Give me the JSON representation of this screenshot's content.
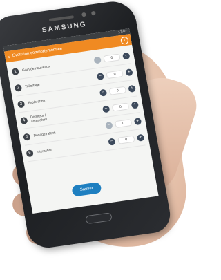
{
  "phone": {
    "brand": "SAMSUNG",
    "status_time": "17:02"
  },
  "app": {
    "title": "Evolution comportementale"
  },
  "rows": [
    {
      "num": "1",
      "label": "Gain de nouveaux",
      "value": "0"
    },
    {
      "num": "2",
      "label": "Toilettage",
      "value": "0"
    },
    {
      "num": "3",
      "label": "Exploration",
      "value": "0"
    },
    {
      "num": "4",
      "label": "Dormeur / somnolent",
      "value": "0"
    },
    {
      "num": "5",
      "label": "Posage ralenti",
      "value": "0"
    },
    {
      "num": "6",
      "label": "Interaction",
      "value": "0"
    }
  ],
  "save_label": "Sauver"
}
